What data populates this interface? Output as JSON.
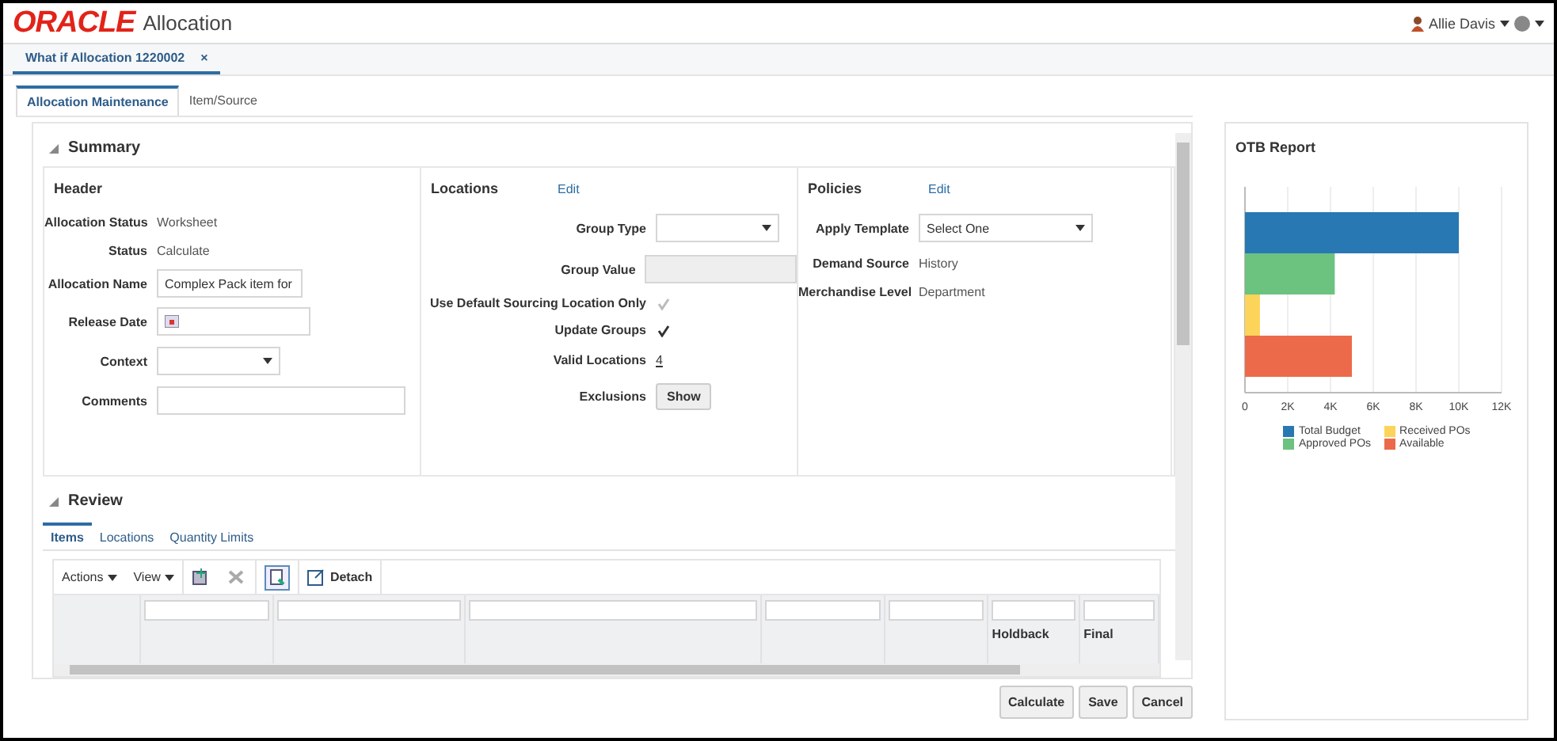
{
  "header": {
    "logo": "ORACLE",
    "app_title": "Allocation",
    "user": "Allie Davis"
  },
  "document_tabs": [
    {
      "label": "What if Allocation 1220002",
      "close": "×",
      "selected": true
    }
  ],
  "page_tabs": [
    {
      "label": "Allocation Maintenance",
      "selected": true
    },
    {
      "label": "Item/Source",
      "selected": false
    }
  ],
  "summary": {
    "title": "Summary",
    "expanded": true,
    "header": {
      "title": "Header",
      "fields": [
        {
          "kind": "text",
          "label": "Allocation Status",
          "value": "Worksheet"
        },
        {
          "kind": "text",
          "label": "Status",
          "value": "Calculate"
        },
        {
          "kind": "input",
          "label": "Allocation Name",
          "value": "Complex Pack item for"
        },
        {
          "kind": "date",
          "label": "Release Date"
        },
        {
          "kind": "select",
          "label": "Context"
        },
        {
          "kind": "wide",
          "label": "Comments"
        }
      ]
    },
    "locations": {
      "title": "Locations",
      "edit": "Edit",
      "fields": [
        {
          "kind": "select",
          "label": "Group Type"
        },
        {
          "kind": "readonly",
          "label": "Group Value"
        },
        {
          "kind": "checkbox",
          "label": "Use Default Sourcing Location Only",
          "checked": true,
          "disabled": true
        },
        {
          "kind": "checkbox",
          "label": "Update Groups",
          "checked": true,
          "disabled": false
        },
        {
          "kind": "link",
          "label": "Valid Locations",
          "value": "4"
        },
        {
          "kind": "button",
          "label": "Exclusions",
          "value": "Show"
        }
      ]
    },
    "policies": {
      "title": "Policies",
      "edit": "Edit",
      "fields": [
        {
          "kind": "select",
          "label": "Apply Template",
          "value": "Select One"
        },
        {
          "kind": "text",
          "label": "Demand Source",
          "value": "History"
        },
        {
          "kind": "text",
          "label": "Merchandise Level",
          "value": "Department"
        }
      ]
    }
  },
  "review": {
    "title": "Review",
    "expanded": true,
    "tabs": [
      {
        "label": "Items",
        "selected": true
      },
      {
        "label": "Locations",
        "selected": false
      },
      {
        "label": "Quantity Limits",
        "selected": false
      }
    ],
    "toolbar": {
      "actions": "Actions",
      "view": "View",
      "detach": "Detach"
    },
    "columns": [
      {
        "kind": "select"
      },
      {
        "kind": "data"
      },
      {
        "kind": "data"
      },
      {
        "kind": "data"
      },
      {
        "kind": "data"
      },
      {
        "kind": "data"
      },
      {
        "kind": "data",
        "heading": "Holdback"
      },
      {
        "kind": "data",
        "heading": "Final"
      }
    ]
  },
  "buttons": [
    "Calculate",
    "Save",
    "Cancel"
  ],
  "otb_report": {
    "title": "OTB Report",
    "chart_data": {
      "type": "bar",
      "orientation": "horizontal",
      "grid": true,
      "xlim": [
        0,
        12000
      ],
      "xticks": [
        {
          "value": 0,
          "label": "0"
        },
        {
          "value": 2000,
          "label": "2K"
        },
        {
          "value": 4000,
          "label": "4K"
        },
        {
          "value": 6000,
          "label": "6K"
        },
        {
          "value": 8000,
          "label": "8K"
        },
        {
          "value": 10000,
          "label": "10K"
        },
        {
          "value": 12000,
          "label": "12K"
        }
      ],
      "series": [
        {
          "name": "Total Budget",
          "color": "#2878b4",
          "values": [
            10000
          ]
        },
        {
          "name": "Approved POs",
          "color": "#6cc27f",
          "values": [
            4200
          ]
        },
        {
          "name": "Received POs",
          "color": "#fcd45a",
          "values": [
            700
          ]
        },
        {
          "name": "Available",
          "color": "#ec6a4a",
          "values": [
            5000
          ]
        }
      ]
    }
  }
}
